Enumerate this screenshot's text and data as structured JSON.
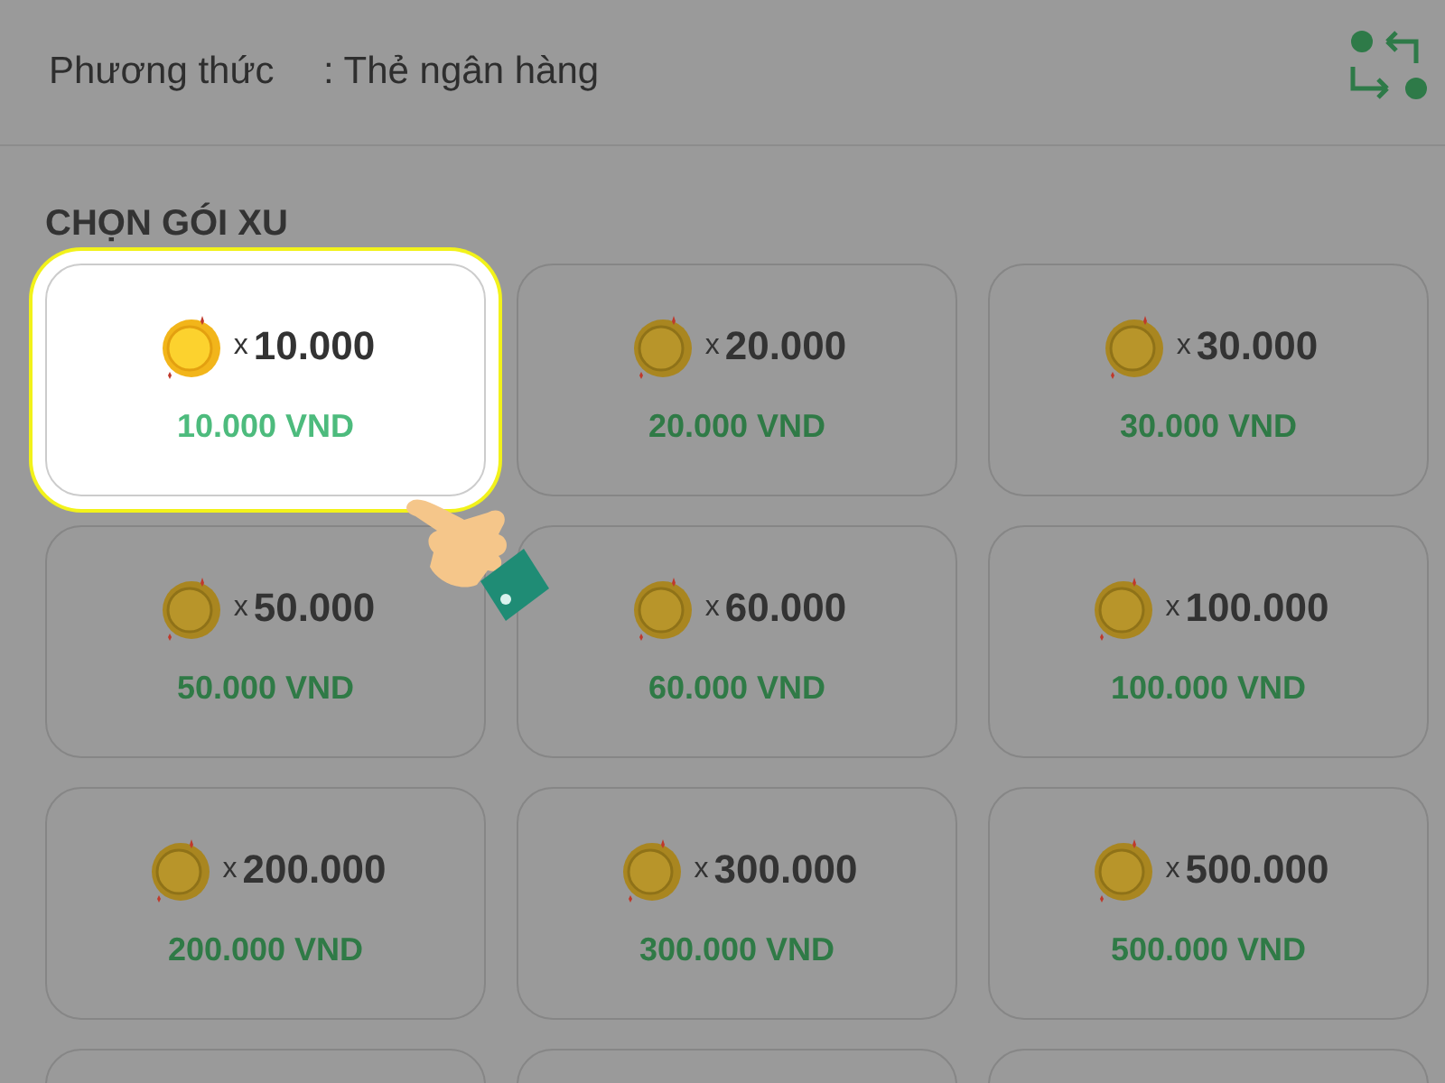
{
  "header": {
    "label": "Phương thức",
    "value": ": Thẻ ngân hàng"
  },
  "section_title": "CHỌN GÓI XU",
  "packages": [
    {
      "multiplier": "x",
      "amount": "10.000",
      "price": "10.000 VND",
      "selected": true
    },
    {
      "multiplier": "x",
      "amount": "20.000",
      "price": "20.000 VND",
      "selected": false
    },
    {
      "multiplier": "x",
      "amount": "30.000",
      "price": "30.000 VND",
      "selected": false
    },
    {
      "multiplier": "x",
      "amount": "50.000",
      "price": "50.000 VND",
      "selected": false
    },
    {
      "multiplier": "x",
      "amount": "60.000",
      "price": "60.000 VND",
      "selected": false
    },
    {
      "multiplier": "x",
      "amount": "100.000",
      "price": "100.000 VND",
      "selected": false
    },
    {
      "multiplier": "x",
      "amount": "200.000",
      "price": "200.000 VND",
      "selected": false
    },
    {
      "multiplier": "x",
      "amount": "300.000",
      "price": "300.000 VND",
      "selected": false
    },
    {
      "multiplier": "x",
      "amount": "500.000",
      "price": "500.000 VND",
      "selected": false
    },
    {
      "selected": false
    },
    {
      "selected": false
    },
    {
      "selected": false
    }
  ]
}
